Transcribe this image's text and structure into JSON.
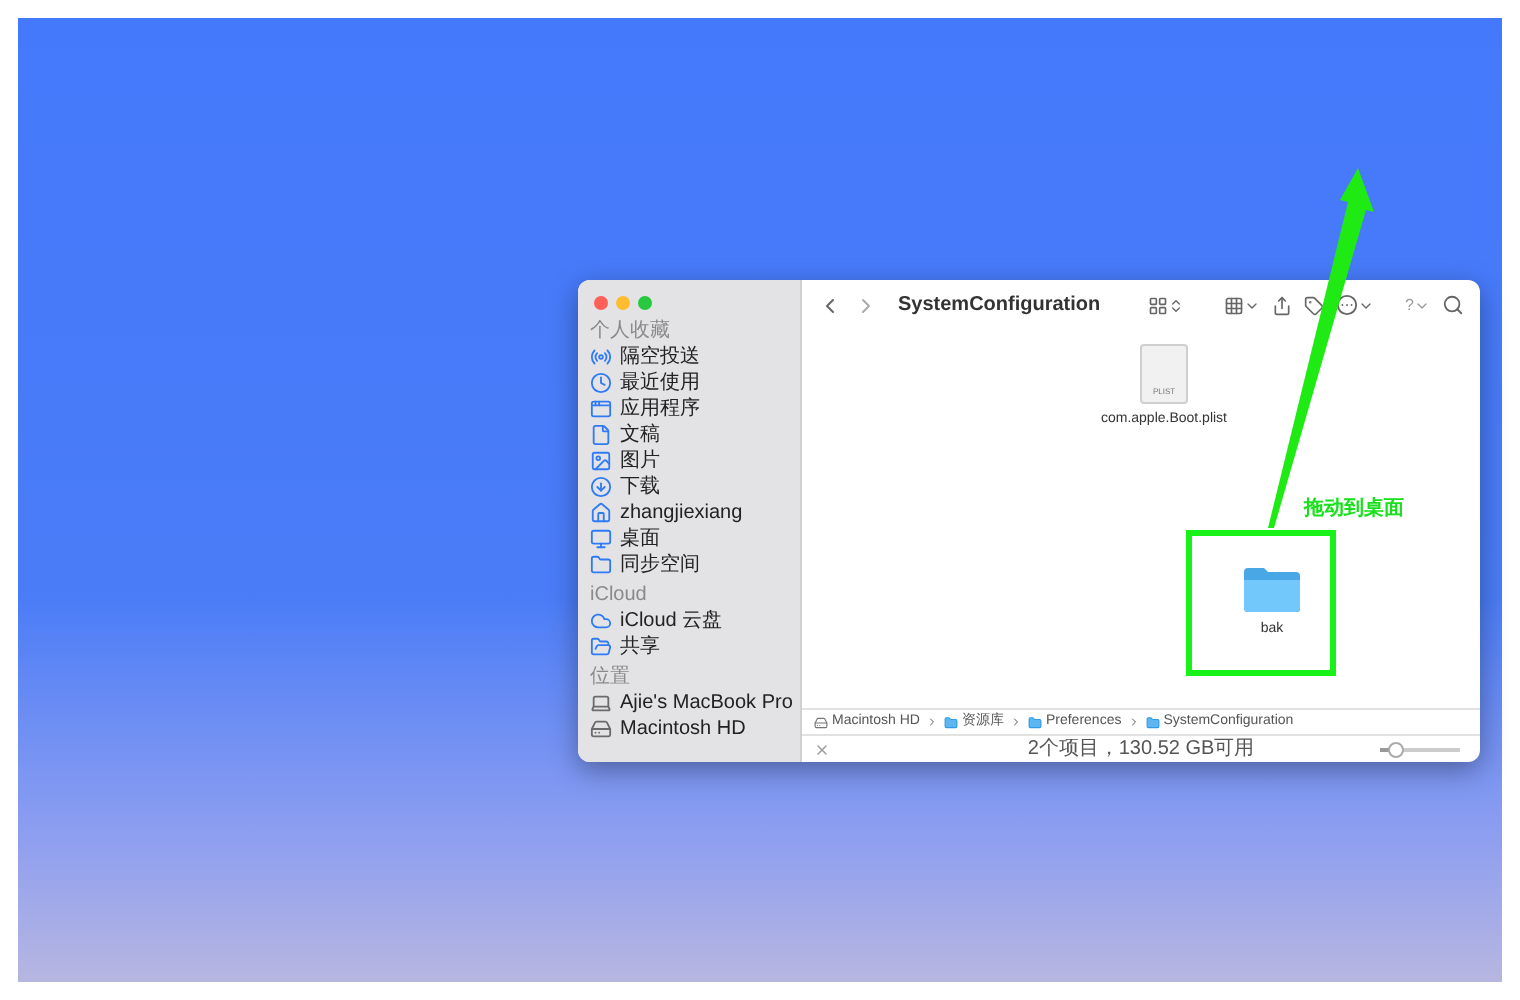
{
  "window": {
    "title": "SystemConfiguration",
    "help": "?"
  },
  "sidebar": [
    {
      "header": "个人收藏",
      "items": [
        {
          "label": "隔空投送"
        },
        {
          "label": "最近使用"
        },
        {
          "label": "应用程序"
        },
        {
          "label": "文稿"
        },
        {
          "label": "图片"
        },
        {
          "label": "下载"
        },
        {
          "label": "zhangjiexiang"
        },
        {
          "label": "桌面"
        },
        {
          "label": "同步空间"
        }
      ]
    },
    {
      "header": "iCloud",
      "items": [
        {
          "label": "iCloud 云盘"
        },
        {
          "label": "共享"
        }
      ]
    },
    {
      "header": "位置",
      "items": [
        {
          "label": "Ajie's MacBook Pro"
        },
        {
          "label": "Macintosh HD"
        }
      ]
    }
  ],
  "files": [
    {
      "name": "com.apple.Boot.plist",
      "kind": "plist",
      "badge": "PLIST"
    },
    {
      "name": "bak",
      "kind": "folder"
    }
  ],
  "path": [
    {
      "label": "Macintosh HD",
      "kind": "disk"
    },
    {
      "label": "资源库",
      "kind": "folder"
    },
    {
      "label": "Preferences",
      "kind": "folder"
    },
    {
      "label": "SystemConfiguration",
      "kind": "folder"
    }
  ],
  "status": {
    "text": "2个项目，130.52 GB可用",
    "zoom": {
      "level": 0.2
    }
  },
  "annotation": {
    "label": "拖动到桌面"
  }
}
